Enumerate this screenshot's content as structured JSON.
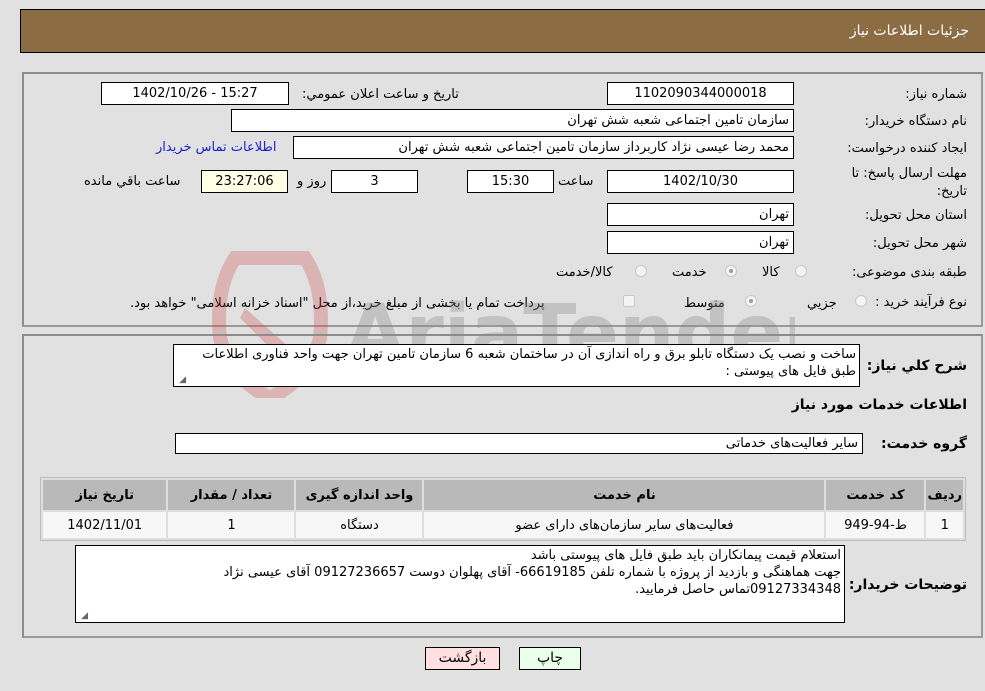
{
  "header": {
    "title": "جزئیات اطلاعات نیاز"
  },
  "details": {
    "need_number": {
      "label": "شماره نیاز:",
      "value": "1102090344000018"
    },
    "announce_datetime": {
      "label": "تاریخ و ساعت اعلان عمومي:",
      "value": "1402/10/26 - 15:27"
    },
    "buyer_org": {
      "label": "نام دستگاه خريدار:",
      "value": "سازمان تامين اجتماعی شعبه شش تهران"
    },
    "requester": {
      "label": "ایجاد کننده درخواست:",
      "value": "محمد رضا  عیسی نژاد کاربرداز سازمان تامين اجتماعی شعبه شش تهران"
    },
    "buyer_contact_link": "اطلاعات تماس خريدار",
    "deadline": {
      "label_line1": "مهلت ارسال پاسخ: تا",
      "label_line2": "تاریخ:",
      "date": "1402/10/30",
      "time_label": "ساعت",
      "time": "15:30",
      "days": "3",
      "days_label": "روز و",
      "remaining": "23:27:06",
      "remaining_label": "ساعت باقي مانده"
    },
    "province": {
      "label": "استان محل تحویل:",
      "value": "تهران"
    },
    "city": {
      "label": "شهر محل تحویل:",
      "value": "تهران"
    },
    "category": {
      "label": "طبقه بندی موضوعی:",
      "options": [
        {
          "label": "کالا",
          "selected": false
        },
        {
          "label": "خدمت",
          "selected": true
        },
        {
          "label": "کالا/خدمت",
          "selected": false
        }
      ]
    },
    "process": {
      "label": "نوع فرآیند خرید :",
      "options": [
        {
          "label": "جزيي",
          "selected": false
        },
        {
          "label": "متوسط",
          "selected": true
        }
      ],
      "treasury_note": "پرداخت تمام یا بخشی از مبلغ خرید،از محل \"اسناد خزانه اسلامی\" خواهد بود.",
      "treasury_checked": false
    }
  },
  "summary": {
    "label": "شرح کلي نياز:",
    "value": "ساخت و نصب یک دستگاه تابلو برق و راه اندازی آن در ساختمان شعبه 6  سازمان تامین تهران جهت واحد فناوری اطلاعات طبق فایل های پیوستی :"
  },
  "services": {
    "section_title": "اطلاعات خدمات مورد نياز",
    "group_label": "گروه خدمت:",
    "group_value": "سایر فعالیت‌های خدماتی",
    "table": {
      "headers": [
        "رديف",
        "کد خدمت",
        "نام خدمت",
        "واحد اندازه گيری",
        "تعداد / مقدار",
        "تاريخ نياز"
      ],
      "rows": [
        [
          "1",
          "ط-94-949",
          "فعالیت‌های سایر سازمان‌های دارای عضو",
          "دستگاه",
          "1",
          "1402/11/01"
        ]
      ]
    }
  },
  "buyer_notes": {
    "label": "توضيحات خريدار:",
    "lines": [
      "استعلام قیمت پیمانکاران باید طبق فایل های پیوستی باشد",
      "جهت هماهنگی و بازدید از پروژه با شماره تلفن 66619185- آقای پهلوان دوست 09127236657  آقای عیسی نژاد",
      "09127334348تماس حاصل فرمایید."
    ]
  },
  "buttons": {
    "print": "چاپ",
    "back": "بازگشت"
  },
  "watermark": {
    "text": "AriaTender.neT"
  },
  "colors": {
    "header_bg": "#8b6c43",
    "print_bg": "#eaffea",
    "back_bg": "#ffe0e0",
    "link": "#1a23c8"
  }
}
